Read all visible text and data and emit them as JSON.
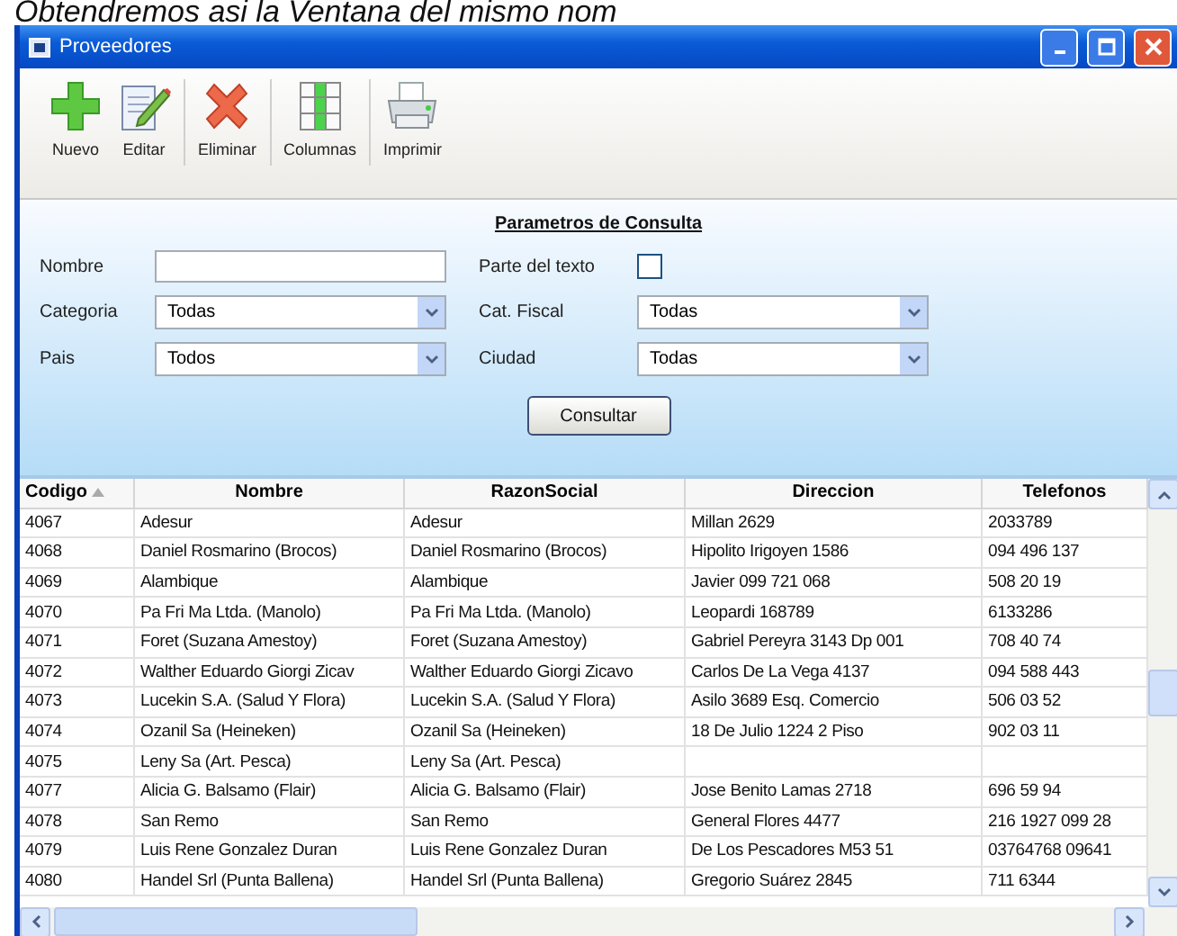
{
  "caption": "Obtendremos asi la Ventana del mismo nom",
  "window": {
    "title": "Proveedores"
  },
  "toolbar": [
    {
      "kind": "new",
      "label": "Nuevo"
    },
    {
      "kind": "edit",
      "label": "Editar"
    },
    {
      "kind": "delete",
      "label": "Eliminar"
    },
    {
      "kind": "columns",
      "label": "Columnas"
    },
    {
      "kind": "print",
      "label": "Imprimir"
    }
  ],
  "params": {
    "title": "Parametros de Consulta",
    "name_label": "Nombre",
    "part_label": "Parte del texto",
    "part_checked": false,
    "combos": [
      {
        "label": "Categoria",
        "value": "Todas"
      },
      {
        "label": "Cat. Fiscal",
        "value": "Todas"
      },
      {
        "label": "Pais",
        "value": "Todos"
      },
      {
        "label": "Ciudad",
        "value": "Todas"
      }
    ],
    "button": "Consultar"
  },
  "table": {
    "columns": [
      {
        "label": "Codigo",
        "sorted": true
      },
      {
        "label": "Nombre",
        "sorted": false
      },
      {
        "label": "RazonSocial",
        "sorted": false
      },
      {
        "label": "Direccion",
        "sorted": false
      },
      {
        "label": "Telefonos",
        "sorted": false
      }
    ],
    "rows": [
      [
        "4067",
        "Adesur",
        "Adesur",
        "Millan 2629",
        "2033789"
      ],
      [
        "4068",
        "Daniel Rosmarino (Brocos)",
        "Daniel Rosmarino (Brocos)",
        "Hipolito Irigoyen 1586",
        "094 496 137"
      ],
      [
        "4069",
        "Alambique",
        "Alambique",
        "Javier 099 721 068",
        "508 20 19"
      ],
      [
        "4070",
        "Pa Fri Ma Ltda. (Manolo)",
        "Pa Fri Ma Ltda. (Manolo)",
        "Leopardi 168789",
        "6133286"
      ],
      [
        "4071",
        "Foret (Suzana Amestoy)",
        "Foret (Suzana Amestoy)",
        "Gabriel Pereyra 3143 Dp 001",
        "708 40 74"
      ],
      [
        "4072",
        "Walther Eduardo Giorgi Zicav",
        "Walther Eduardo Giorgi Zicavo",
        "Carlos De La Vega 4137",
        "094 588 443"
      ],
      [
        "4073",
        "Lucekin S.A. (Salud Y Flora)",
        "Lucekin S.A. (Salud Y Flora)",
        "Asilo 3689 Esq. Comercio",
        "506 03 52"
      ],
      [
        "4074",
        "Ozanil Sa (Heineken)",
        "Ozanil Sa (Heineken)",
        "18 De Julio 1224 2 Piso",
        "902 03 11"
      ],
      [
        "4075",
        "Leny Sa (Art. Pesca)",
        "Leny Sa (Art. Pesca)",
        "",
        ""
      ],
      [
        "4077",
        "Alicia G. Balsamo (Flair)",
        "Alicia G. Balsamo (Flair)",
        "Jose Benito Lamas 2718",
        "696 59 94"
      ],
      [
        "4078",
        "San Remo",
        "San Remo",
        "General Flores 4477",
        "216 1927 099 28"
      ],
      [
        "4079",
        "Luis Rene Gonzalez Duran",
        "Luis Rene Gonzalez Duran",
        "De Los Pescadores M53 51",
        "03764768 09641"
      ],
      [
        "4080",
        "Handel Srl (Punta Ballena)",
        "Handel Srl (Punta Ballena)",
        "Gregorio Suárez 2845",
        "711 6344"
      ]
    ]
  }
}
